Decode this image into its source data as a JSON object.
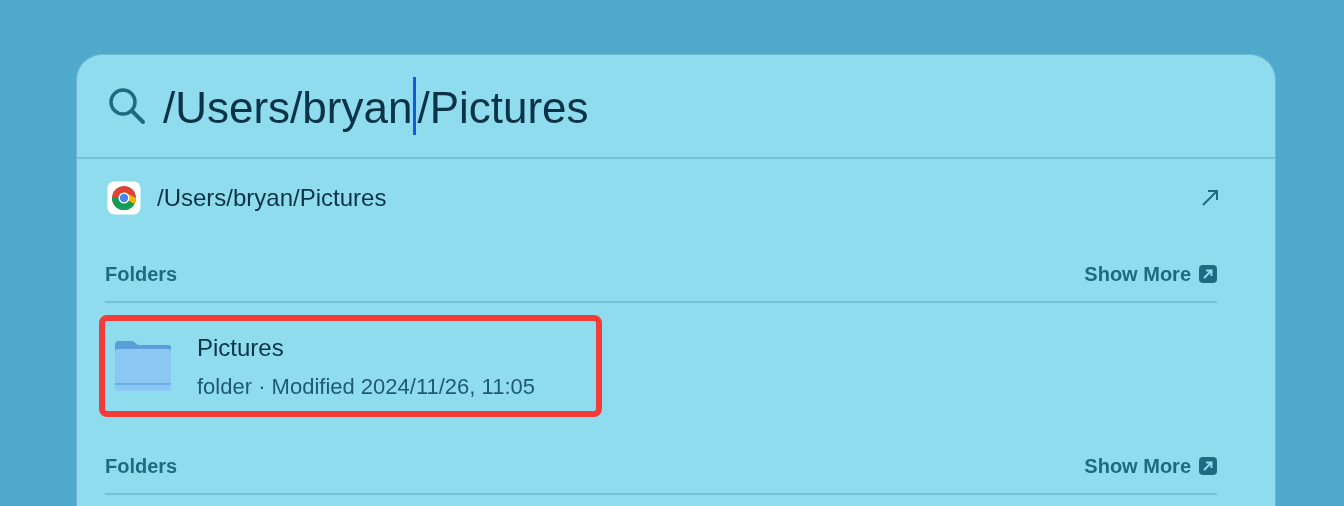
{
  "search": {
    "query": {
      "before_cursor": "/Users/bryan",
      "after_cursor": "/Pictures"
    }
  },
  "top_hit": {
    "title": "/Users/bryan/Pictures"
  },
  "sections": [
    {
      "title": "Folders",
      "show_more": "Show More",
      "items": [
        {
          "title": "Pictures",
          "subtitle": "folder · Modified 2024/11/26, 11:05",
          "highlighted": true
        }
      ]
    },
    {
      "title": "Folders",
      "show_more": "Show More"
    }
  ]
}
